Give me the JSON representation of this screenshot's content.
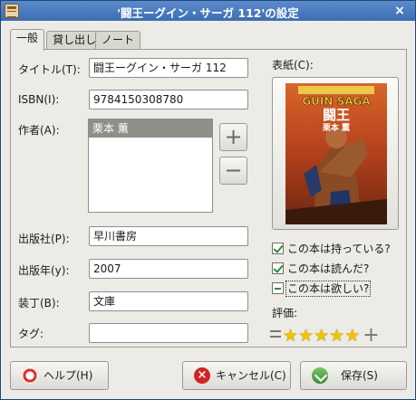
{
  "window": {
    "title": "'闘王ーグイン・サーガ 112'の設定",
    "close_glyph": "×"
  },
  "tabs": [
    {
      "label": "一般",
      "active": true
    },
    {
      "label": "貸し出し",
      "active": false
    },
    {
      "label": "ノート",
      "active": false
    }
  ],
  "fields": {
    "title_label": "タイトル(T):",
    "title_value": "闘王ーグイン・サーガ 112",
    "isbn_label": "ISBN(I):",
    "isbn_value": "9784150308780",
    "authors_label": "作者(A):",
    "authors": [
      "栗本 薫"
    ],
    "publisher_label": "出版社(P):",
    "publisher_value": "早川書房",
    "year_label": "出版年(y):",
    "year_value": "2007",
    "binding_label": "装丁(B):",
    "binding_value": "文庫",
    "tags_label": "タグ:",
    "tags_value": ""
  },
  "author_buttons": {
    "add": "+",
    "remove": "−"
  },
  "cover": {
    "label": "表紙(C):",
    "art_title": "闘王",
    "art_author": "栗本 薫",
    "art_series": "GUIN SAGA"
  },
  "checks": [
    {
      "label": "この本は持っている?",
      "state": "checked"
    },
    {
      "label": "この本は読んだ?",
      "state": "checked"
    },
    {
      "label": "この本は欲しい?",
      "state": "mixed"
    }
  ],
  "rating": {
    "label": "評価:",
    "value": 5,
    "max": 5,
    "star_glyph": "★",
    "clear_glyph": "=",
    "add_glyph": "+"
  },
  "buttons": {
    "help": "ヘルプ(H)",
    "cancel": "キャンセル(C)",
    "save": "保存(S)",
    "cancel_glyph": "×"
  },
  "icons": {
    "app": "book-app-icon",
    "help": "lifebuoy-icon",
    "cancel": "cancel-x-icon",
    "save": "save-down-arrow-icon"
  }
}
